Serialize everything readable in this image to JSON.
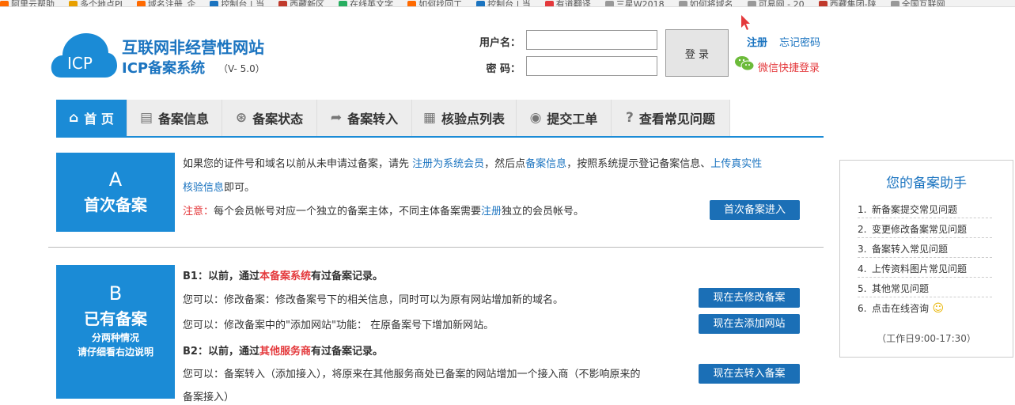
{
  "bookmarks": [
    {
      "label": "阿里云帮助",
      "color": "#ff6a00"
    },
    {
      "label": "多个地点PI",
      "color": "#e8a000"
    },
    {
      "label": "域名注册_企",
      "color": "#ff6a00"
    },
    {
      "label": "控制台 | 当",
      "color": "#1b74c0"
    },
    {
      "label": "西藏新区",
      "color": "#c0392b"
    },
    {
      "label": "在线英文字",
      "color": "#27ae60"
    },
    {
      "label": "如何找回工",
      "color": "#ff6a00"
    },
    {
      "label": "控制台 | 当",
      "color": "#1b74c0"
    },
    {
      "label": "有道翻译",
      "color": "#e4393c"
    },
    {
      "label": "三星W2018",
      "color": "#999999"
    },
    {
      "label": "如何将域名",
      "color": "#999999"
    },
    {
      "label": "可易网 - 20",
      "color": "#999999"
    },
    {
      "label": "西藏集团-陕",
      "color": "#c0392b"
    },
    {
      "label": "全国互联网",
      "color": "#999999"
    }
  ],
  "logo": {
    "icp": "ICP",
    "title1": "互联网非经营性网站",
    "title2": "ICP备案系统",
    "version": "（V- 5.0）"
  },
  "login": {
    "username_label": "用户名：",
    "password_label": "密  码：",
    "username_value": "",
    "password_value": "",
    "submit_label": "登 录",
    "register_label": "注册",
    "forgot_label": "忘记密码",
    "wechat_label": "微信快捷登录"
  },
  "nav": {
    "tabs": [
      {
        "label": "首 页",
        "icon": "home-icon",
        "glyph": "⌂",
        "active": true,
        "width": 90
      },
      {
        "label": "备案信息",
        "icon": "document-icon",
        "glyph": "▤",
        "active": false,
        "width": 120
      },
      {
        "label": "备案状态",
        "icon": "lifebuoy-icon",
        "glyph": "⊛",
        "active": false,
        "width": 120
      },
      {
        "label": "备案转入",
        "icon": "forward-icon",
        "glyph": "➦",
        "active": false,
        "width": 120
      },
      {
        "label": "核验点列表",
        "icon": "list-icon",
        "glyph": "▦",
        "active": false,
        "width": 132
      },
      {
        "label": "提交工单",
        "icon": "user-icon",
        "glyph": "◉",
        "active": false,
        "width": 120
      },
      {
        "label": "查看常见问题",
        "icon": "question-icon",
        "glyph": "?",
        "active": false,
        "width": 150
      }
    ]
  },
  "sectionA": {
    "letter": "A",
    "name": "首次备案",
    "line1a": "如果您的证件号和域名以前从未申请过备案，请先 ",
    "line1_link1": "注册为系统会员",
    "line1b": "，然后点",
    "line1_link2": "备案信息",
    "line1c": "，按照系统提示登记备案信息、",
    "line1_link3": "上传真实性",
    "line2_link": "核验信息",
    "line2b": "即可。",
    "note_label": "注意：",
    "note_text_a": "每个会员帐号对应一个独立的备案主体，不同主体备案需要",
    "note_link": "注册",
    "note_text_b": "独立的会员帐号。",
    "button": "首次备案进入"
  },
  "sectionB": {
    "letter": "B",
    "name": "已有备案",
    "sub1": "分两种情况",
    "sub2": "请仔细看右边说明",
    "b1_prefix": "B1：以前，通过",
    "b1_highlight": "本备案系统",
    "b1_suffix": "有过备案记录。",
    "b1_line1": "您可以：修改备案：修改备案号下的相关信息，同时可以为原有网站增加新的域名。",
    "b1_line2": "您可以：修改备案中的\"添加网站\"功能： 在原备案号下增加新网站。",
    "b2_prefix": "B2：以前，通过",
    "b2_highlight": "其他服务商",
    "b2_suffix": "有过备案记录。",
    "b2_line1": "您可以：备案转入（添加接入），将原来在其他服务商处已备案的网站增加一个接入商（不影响原来的",
    "b2_line2": "备案接入）",
    "btn_modify": "现在去修改备案",
    "btn_add": "现在去添加网站",
    "btn_transfer": "现在去转入备案"
  },
  "helper": {
    "title": "您的备案助手",
    "items": [
      {
        "num": "1.",
        "label": "新备案提交常见问题"
      },
      {
        "num": "2.",
        "label": "变更修改备案常见问题"
      },
      {
        "num": "3.",
        "label": "备案转入常见问题"
      },
      {
        "num": "4.",
        "label": "上传资料图片常见问题"
      },
      {
        "num": "5.",
        "label": "其他常见问题"
      },
      {
        "num": "6.",
        "label": "点击在线咨询"
      }
    ],
    "hours": "（工作日9:00-17:30）"
  }
}
